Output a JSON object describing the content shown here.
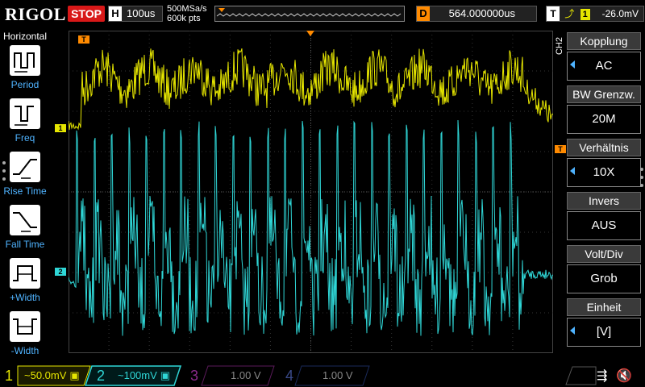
{
  "header": {
    "logo": "RIGOL",
    "run_state": "STOP",
    "timebase_key": "H",
    "timebase": "100us",
    "sample_rate": "500MSa/s",
    "memory_depth": "600k pts",
    "delay_key": "D",
    "delay": "564.000000us",
    "trigger_key": "T",
    "trigger_channel": "1",
    "trigger_level": "-26.0mV"
  },
  "left_menu": {
    "title": "Horizontal",
    "items": [
      {
        "label": "Period",
        "icon": "period-icon"
      },
      {
        "label": "Freq",
        "icon": "frequency-icon"
      },
      {
        "label": "Rise Time",
        "icon": "rise-time-icon"
      },
      {
        "label": "Fall Time",
        "icon": "fall-time-icon"
      },
      {
        "label": "+Width",
        "icon": "positive-width-icon"
      },
      {
        "label": "-Width",
        "icon": "negative-width-icon"
      }
    ]
  },
  "right_menu": {
    "channel_tag": "CH2",
    "items": [
      {
        "title": "Kopplung",
        "value": "AC",
        "has_arrow": true
      },
      {
        "title": "BW Grenzw.",
        "value": "20M",
        "has_arrow": false
      },
      {
        "title": "Verhältnis",
        "value": "10X",
        "has_arrow": true
      },
      {
        "title": "Invers",
        "value": "AUS",
        "has_arrow": false
      },
      {
        "title": "Volt/Div",
        "value": "Grob",
        "has_arrow": false
      },
      {
        "title": "Einheit",
        "value": "[V]",
        "has_arrow": true
      }
    ]
  },
  "markers": {
    "ch1": "1",
    "ch2": "2",
    "trigger": "T"
  },
  "channels": [
    {
      "num": "1",
      "scale": "50.0mV",
      "coupling_symbol": "~",
      "color": "#e6e600",
      "active": true
    },
    {
      "num": "2",
      "scale": "100mV",
      "coupling_symbol": "~",
      "color": "#2fd6d6",
      "active": true
    },
    {
      "num": "3",
      "scale": "1.00 V",
      "coupling_symbol": "",
      "color": "#c020c0",
      "active": false
    },
    {
      "num": "4",
      "scale": "1.00 V",
      "coupling_symbol": "",
      "color": "#3060e0",
      "active": false
    }
  ],
  "colors": {
    "ch1": "#e6e600",
    "ch2": "#2fd6d6",
    "stop": "#d81818",
    "delay": "#ff8a00",
    "accent": "#4fb3ff"
  }
}
